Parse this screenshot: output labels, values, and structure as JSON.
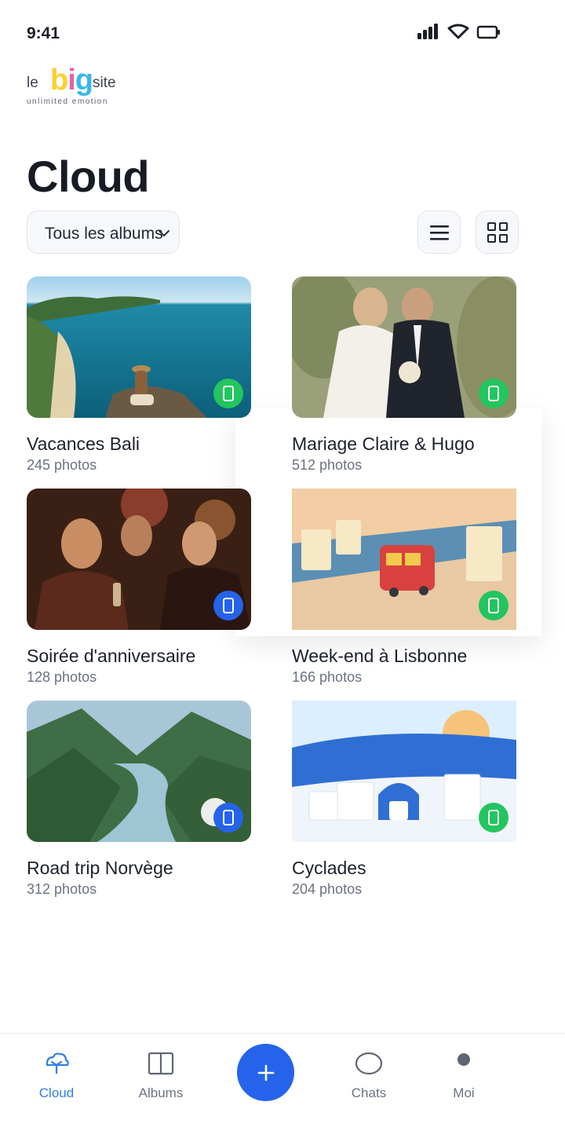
{
  "status": {
    "time": "9:41"
  },
  "logo": {
    "le": "le",
    "big_b": "b",
    "big_i": "i",
    "big_g": "g",
    "site": "site",
    "tagline": "unlimited emotion"
  },
  "page": {
    "title": "Cloud"
  },
  "filter": {
    "selected": "Tous les albums"
  },
  "albums": [
    {
      "title": "Vacances Bali",
      "count": "245 photos",
      "badge_color": "#22c55e",
      "badge_icon": "phone-icon"
    },
    {
      "title": "Mariage Claire & Hugo",
      "count": "512 photos",
      "badge_color": "#22c55e",
      "badge_icon": "phone-icon"
    },
    {
      "title": "Soirée d'anniversaire",
      "count": "128 photos",
      "badge_color": "#2563eb",
      "badge_icon": "phone-icon"
    },
    {
      "title": "Week-end à Lisbonne",
      "count": "166 photos",
      "badge_color": "#22c55e",
      "badge_icon": "phone-icon"
    },
    {
      "title": "Road trip Norvège",
      "count": "312 photos",
      "badge_color": "#2563eb",
      "badge_icon": "phone-icon"
    },
    {
      "title": "Cyclades",
      "count": "204 photos",
      "badge_color": "#22c55e",
      "badge_icon": "phone-icon"
    }
  ],
  "nav": {
    "items": [
      {
        "label": "Cloud",
        "icon": "cloud-tree-icon",
        "active": true
      },
      {
        "label": "Albums",
        "icon": "albums-icon",
        "active": false
      },
      {
        "label": "Chats",
        "icon": "chat-bubble-icon",
        "active": false
      },
      {
        "label": "Moi",
        "icon": "profile-dot-icon",
        "active": false
      }
    ],
    "fab_icon": "plus-icon"
  },
  "colors": {
    "accent": "#2563eb",
    "active_nav": "#2f7fe8",
    "green_badge": "#22c55e"
  }
}
